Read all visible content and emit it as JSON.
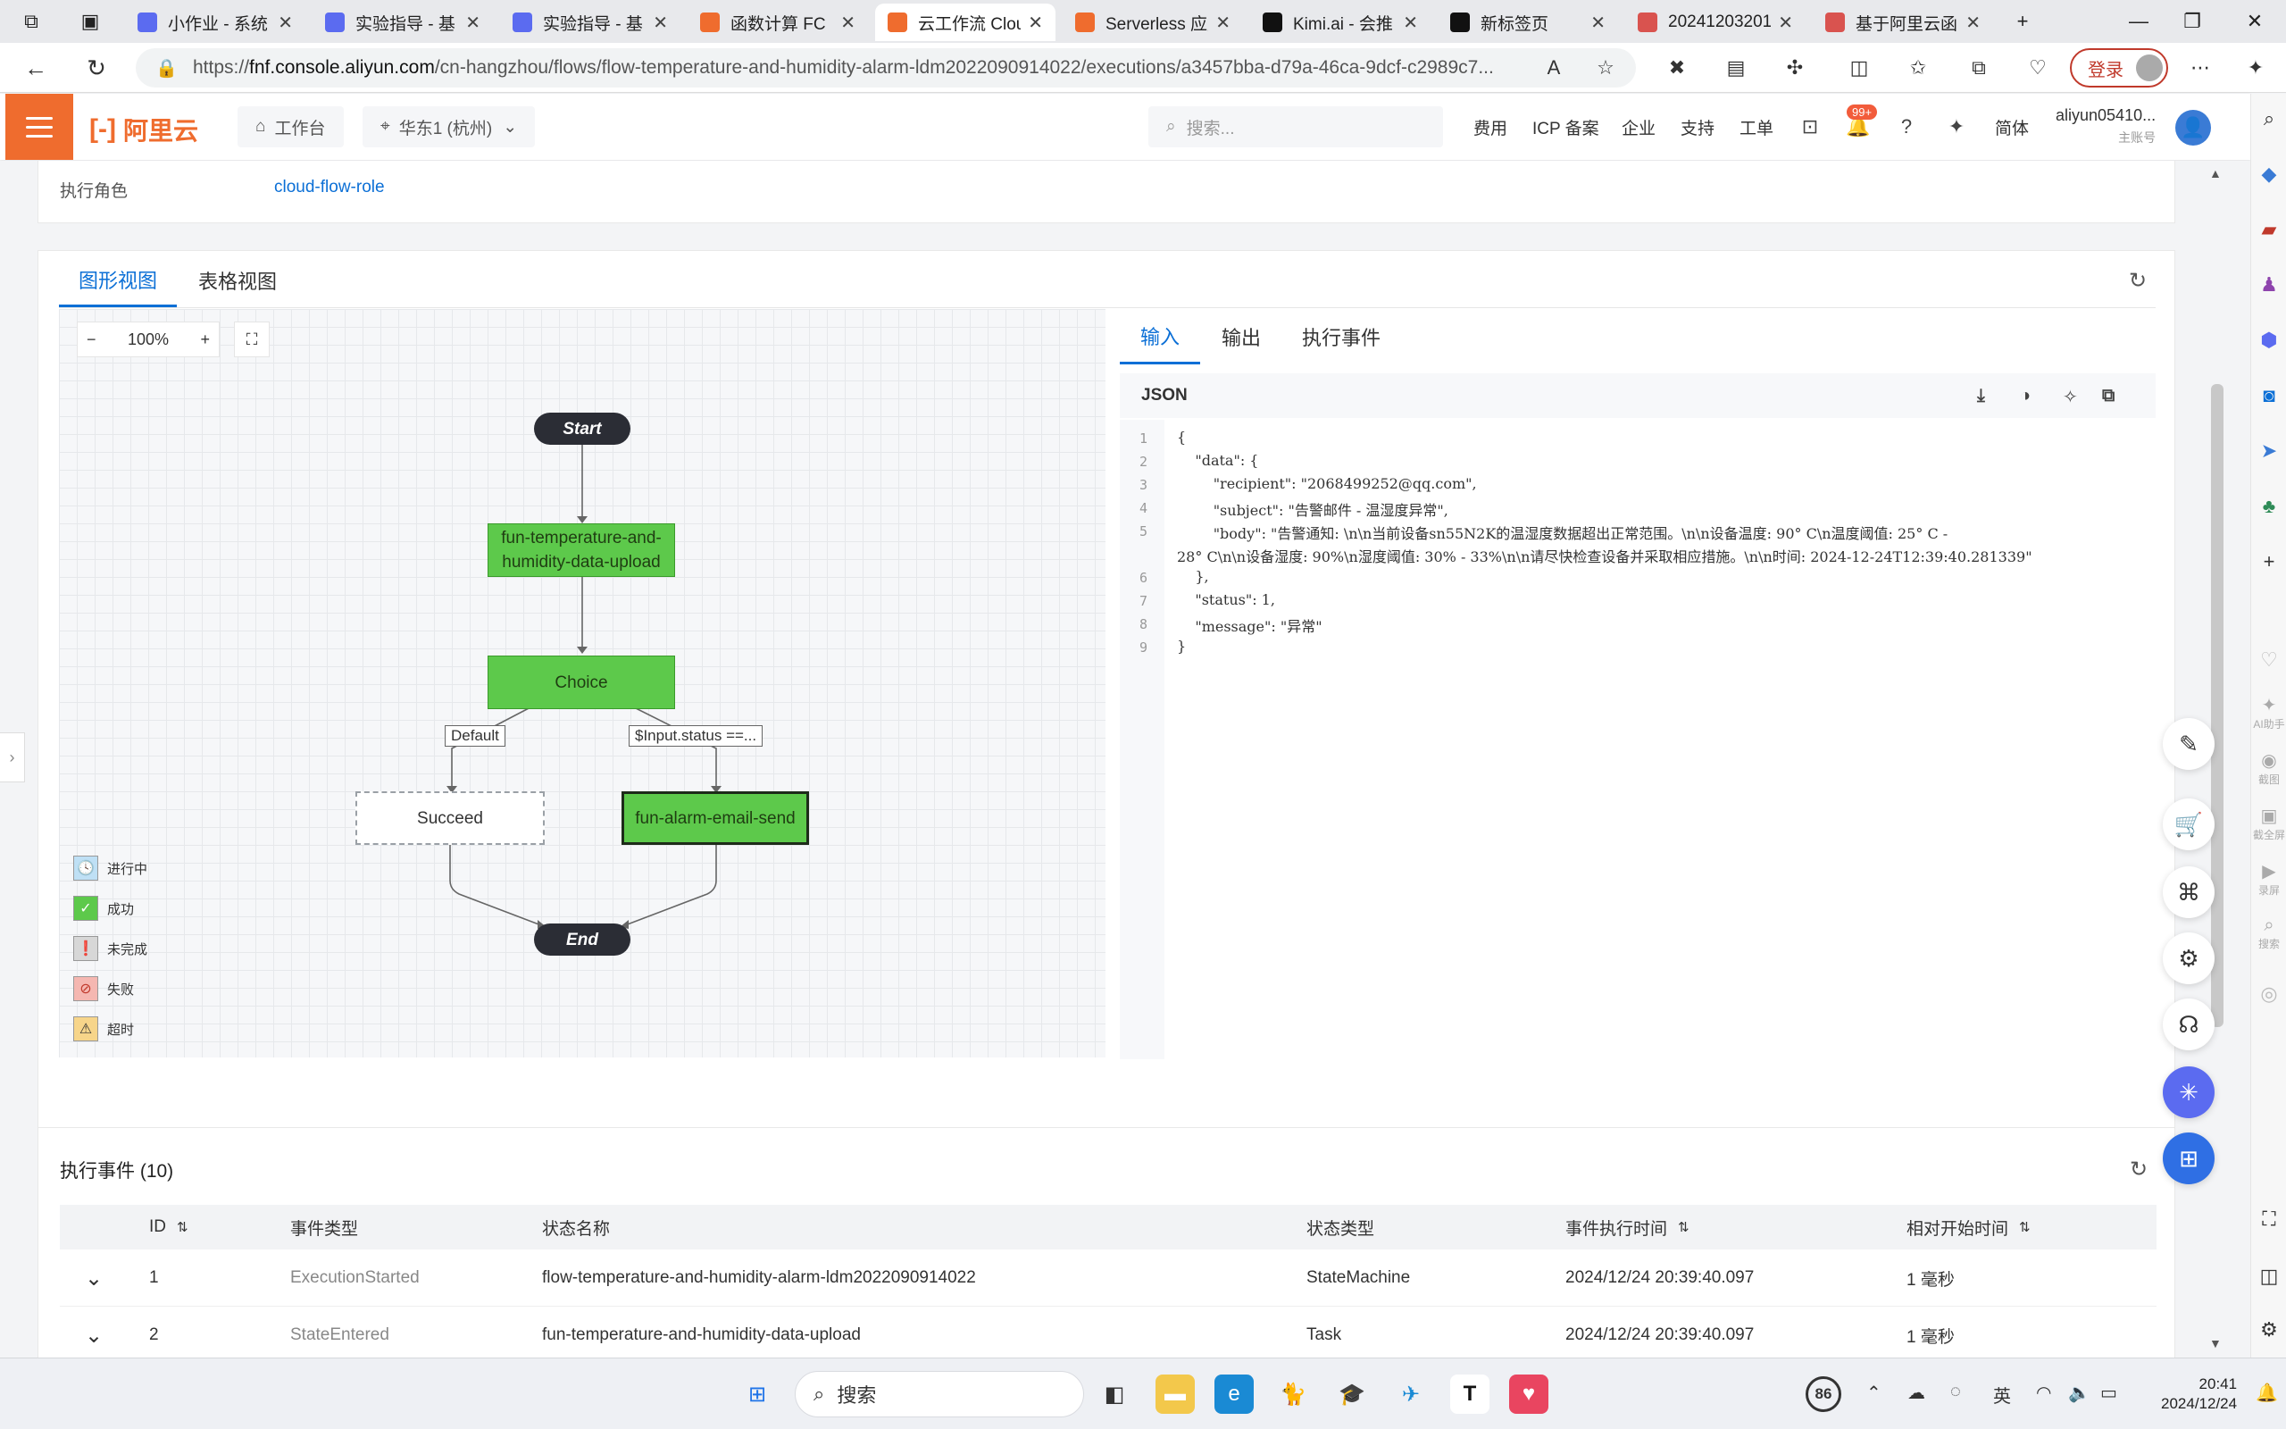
{
  "browser": {
    "tabs": [
      {
        "label": "小作业 - 系统",
        "color": "#5b6bf0",
        "active": false
      },
      {
        "label": "实验指导 - 基",
        "color": "#5b6bf0",
        "active": false
      },
      {
        "label": "实验指导 - 基",
        "color": "#5b6bf0",
        "active": false
      },
      {
        "label": "函数计算 FC",
        "color": "#ef6c2e",
        "active": false
      },
      {
        "label": "云工作流 Clou",
        "color": "#ef6c2e",
        "active": true
      },
      {
        "label": "Serverless 应用",
        "color": "#ef6c2e",
        "active": false
      },
      {
        "label": "Kimi.ai - 会推",
        "color": "#111111",
        "active": false
      },
      {
        "label": "新标签页",
        "color": "#111111",
        "active": false
      },
      {
        "label": "20241203201",
        "color": "#d9534f",
        "active": false
      },
      {
        "label": "基于阿里云函",
        "color": "#d9534f",
        "active": false
      }
    ],
    "url_prefix": "https://",
    "url_host": "fnf.console.aliyun.com",
    "url_path": "/cn-hangzhou/flows/flow-temperature-and-humidity-alarm-ldm2022090914022/executions/a3457bba-d79a-46ca-9dcf-c2989c7...",
    "login_label": "登录"
  },
  "console": {
    "logo_text": "阿里云",
    "workbench": "工作台",
    "region": "华东1 (杭州)",
    "search_placeholder": "搜索...",
    "links": [
      "费用",
      "ICP 备案",
      "企业",
      "支持",
      "工单"
    ],
    "badge": "99+",
    "lang": "简体",
    "account": "aliyun05410...",
    "account_sub": "主账号"
  },
  "info": {
    "role_label": "执行角色",
    "role_value": "cloud-flow-role"
  },
  "panel": {
    "tabs": [
      "图形视图",
      "表格视图"
    ],
    "zoom": "100%",
    "nodes": {
      "start": "Start",
      "upload": "fun-temperature-and-humidity-data-upload",
      "choice": "Choice",
      "default_label": "Default",
      "cond_label": "$Input.status ==...",
      "succeed": "Succeed",
      "alarm": "fun-alarm-email-send",
      "end": "End"
    },
    "legend": [
      "进行中",
      "成功",
      "未完成",
      "失败",
      "超时"
    ]
  },
  "io": {
    "tabs": [
      "输入",
      "输出",
      "执行事件"
    ],
    "json_label": "JSON",
    "lines": [
      {
        "n": "1",
        "text": "{"
      },
      {
        "n": "2",
        "text": "    \"data\": {"
      },
      {
        "n": "3",
        "text": "        \"recipient\": \"2068499252@qq.com\","
      },
      {
        "n": "4",
        "text": "        \"subject\": \"告警邮件 - 温湿度异常\","
      },
      {
        "n": "5",
        "text": "        \"body\": \"告警通知: \\n\\n当前设备sn55N2K的温湿度数据超出正常范围。\\n\\n设备温度: 90° C\\n温度阈值: 25° C -"
      },
      {
        "n": "",
        "text": "28° C\\n\\n设备湿度: 90%\\n湿度阈值: 30% - 33%\\n\\n请尽快检查设备并采取相应措施。\\n\\n时间: 2024-12-24T12:39:40.281339\""
      },
      {
        "n": "6",
        "text": "    },"
      },
      {
        "n": "7",
        "text": "    \"status\": 1,"
      },
      {
        "n": "8",
        "text": "    \"message\": \"异常\""
      },
      {
        "n": "9",
        "text": "}"
      }
    ]
  },
  "events": {
    "title": "执行事件 (10)",
    "columns": [
      "ID",
      "事件类型",
      "状态名称",
      "状态类型",
      "事件执行时间",
      "相对开始时间"
    ],
    "rows": [
      {
        "id": "1",
        "type": "ExecutionStarted",
        "name": "flow-temperature-and-humidity-alarm-ldm2022090914022",
        "state_type": "StateMachine",
        "time": "2024/12/24 20:39:40.097",
        "rel": "1 毫秒"
      },
      {
        "id": "2",
        "type": "StateEntered",
        "name": "fun-temperature-and-humidity-data-upload",
        "state_type": "Task",
        "time": "2024/12/24 20:39:40.097",
        "rel": "1 毫秒"
      }
    ]
  },
  "edgebar": {
    "ai_label": "AI助手",
    "tools": [
      "截图",
      "截全屏",
      "录屏",
      "搜索"
    ]
  },
  "taskbar": {
    "search": "搜索",
    "weather": "86",
    "ime": "英",
    "time": "20:41",
    "date": "2024/12/24"
  }
}
